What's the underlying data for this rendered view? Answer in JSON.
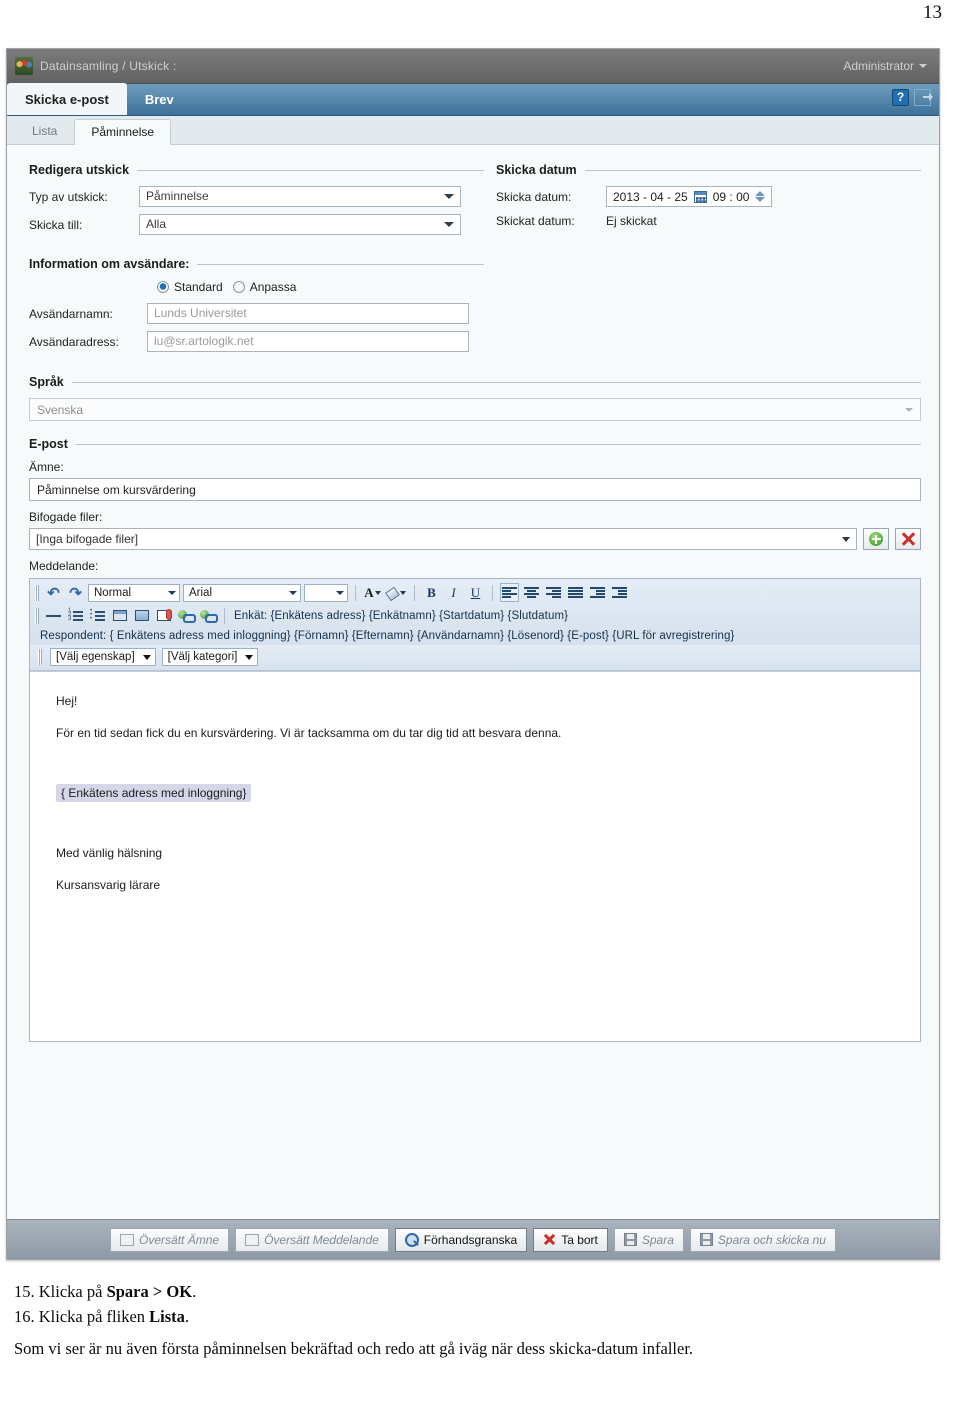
{
  "page": {
    "number": "13"
  },
  "window": {
    "breadcrumb": "Datainsamling / Utskick :",
    "user_menu": "Administrator",
    "help_label": "?",
    "logo_name": "artologik-logo"
  },
  "tabs": {
    "primary": [
      {
        "label": "Skicka e-post",
        "active": true
      },
      {
        "label": "Brev",
        "active": false
      }
    ],
    "secondary": [
      {
        "label": "Lista",
        "active": false
      },
      {
        "label": "Påminnelse",
        "active": true
      }
    ]
  },
  "form": {
    "edit_section": {
      "legend": "Redigera utskick",
      "type_label": "Typ av utskick:",
      "type_value": "Påminnelse",
      "recipient_label": "Skicka till:",
      "recipient_value": "Alla"
    },
    "date_section": {
      "legend": "Skicka datum",
      "send_date_label": "Skicka datum:",
      "send_date_value": "2013 - 04 - 25",
      "send_time_value": "09 : 00",
      "sent_date_label": "Skickat datum:",
      "sent_date_value": "Ej skickat"
    },
    "sender_section": {
      "legend": "Information om avsändare:",
      "radio_standard": "Standard",
      "radio_custom": "Anpassa",
      "selected": "Standard",
      "name_label": "Avsändarnamn:",
      "name_value": "Lunds Universitet",
      "address_label": "Avsändaradress:",
      "address_value": "lu@sr.artologik.net"
    },
    "language_section": {
      "legend": "Språk",
      "value": "Svenska"
    },
    "email_section": {
      "legend": "E-post",
      "subject_label": "Ämne:",
      "subject_value": "Påminnelse om kursvärdering",
      "attachments_label": "Bifogade filer:",
      "attachments_value": "[Inga bifogade filer]",
      "message_label": "Meddelande:"
    }
  },
  "editor": {
    "style_select": "Normal",
    "font_select": "Arial",
    "size_select": "",
    "buttons": {
      "undo": "↶",
      "redo": "↷",
      "bold": "B",
      "italic": "I",
      "underline": "U",
      "font_color": "A"
    },
    "tag_line_survey": "Enkät: {Enkätens adress} {Enkätnamn} {Startdatum} {Slutdatum}",
    "tag_line_respondent": "Respondent: { Enkätens adress med inloggning} {Förnamn} {Efternamn} {Användarnamn} {Lösenord} {E-post} {URL för avregistrering}",
    "property_select": "[Välj egenskap]",
    "category_select": "[Välj kategori]",
    "body": {
      "greeting": "Hej!",
      "paragraph": "För en tid sedan fick du en kursvärdering. Vi är tacksamma om du tar dig tid att besvara denna.",
      "tag": "{ Enkätens adress med inloggning}",
      "signoff": "Med vänlig hälsning",
      "sender": "Kursansvarig lärare"
    }
  },
  "footer_buttons": [
    {
      "label": "Översätt Ämne",
      "icon": "translate-icon",
      "enabled": false
    },
    {
      "label": "Översätt Meddelande",
      "icon": "translate-icon",
      "enabled": false
    },
    {
      "label": "Förhandsgranska",
      "icon": "preview-icon",
      "enabled": true
    },
    {
      "label": "Ta bort",
      "icon": "delete-icon",
      "enabled": true
    },
    {
      "label": "Spara",
      "icon": "save-icon",
      "enabled": false
    },
    {
      "label": "Spara och skicka nu",
      "icon": "save-icon",
      "enabled": false
    }
  ],
  "caption": {
    "step15_prefix": "15. Klicka på ",
    "step15_bold": "Spara > OK",
    "step15_suffix": ".",
    "step16_prefix": "16. Klicka på fliken ",
    "step16_bold": "Lista",
    "step16_suffix": ".",
    "summary": "Som vi ser är nu även första påminnelsen bekräftad och redo att gå iväg när dess skicka-datum infaller."
  }
}
